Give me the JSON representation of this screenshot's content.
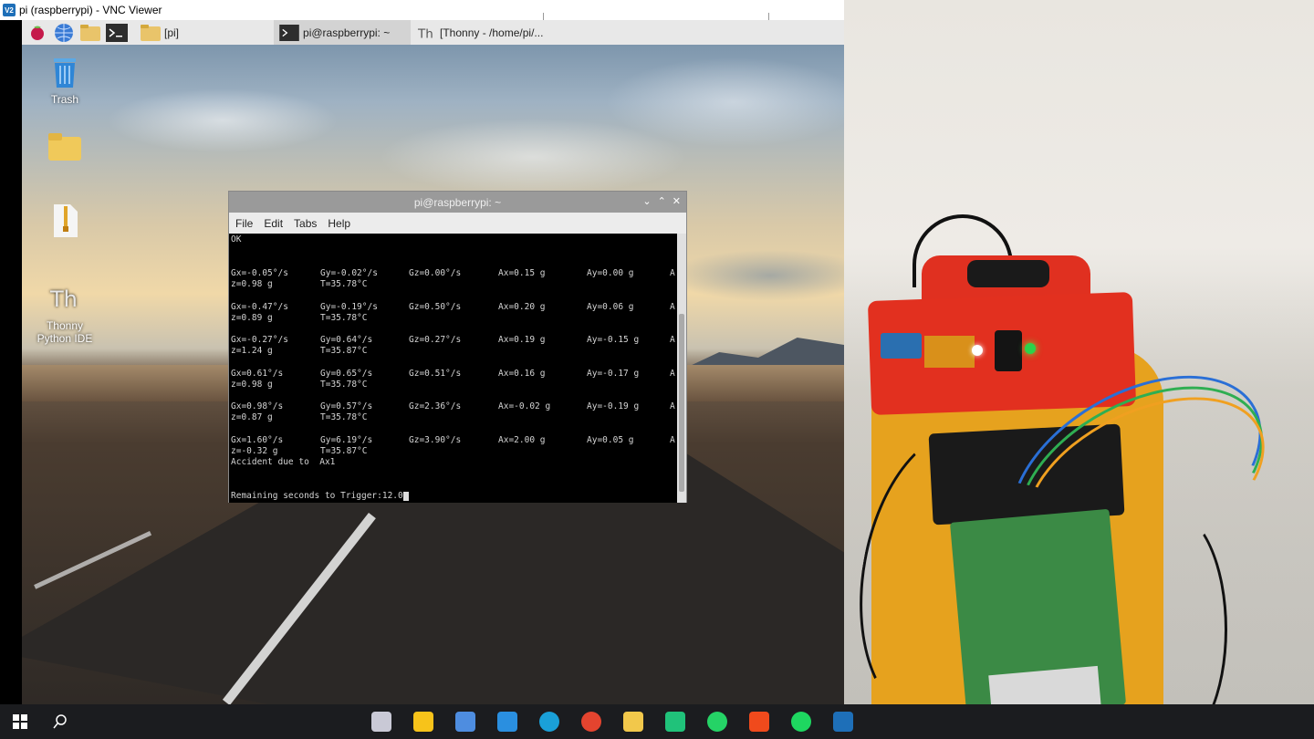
{
  "vnc": {
    "logo": "V2",
    "title": "pi (raspberrypi) - VNC Viewer"
  },
  "pi_taskbar": {
    "launchers": [
      "raspberry-menu-icon",
      "globe-icon",
      "files-icon",
      "terminal-icon"
    ],
    "tasks": [
      {
        "label": "[pi]",
        "icon": "folder-icon",
        "active": false
      },
      {
        "label": "pi@raspberrypi: ~",
        "icon": "terminal-icon",
        "active": true
      },
      {
        "label": "[Thonny  -  /home/pi/...",
        "icon": "thonny-icon",
        "active": false
      }
    ]
  },
  "desktop_icons": [
    {
      "label": "Trash",
      "icon": "trash-icon"
    },
    {
      "label": "",
      "icon": "folder-icon"
    },
    {
      "label": "",
      "icon": "archive-icon"
    },
    {
      "label": "Thonny\nPython IDE",
      "icon": "thonny-icon"
    }
  ],
  "terminal": {
    "title": "pi@raspberrypi: ~",
    "menu": [
      "File",
      "Edit",
      "Tabs",
      "Help"
    ],
    "first_line": "OK",
    "readings": [
      {
        "gx": "Gx=-0.05°/s",
        "gy": "Gy=-0.02°/s",
        "gz": "Gz=0.00°/s",
        "ax": "Ax=0.15 g",
        "ay": "Ay=0.00 g",
        "az": "A",
        "z": "z=0.98 g",
        "t": "T=35.78°C"
      },
      {
        "gx": "Gx=-0.47°/s",
        "gy": "Gy=-0.19°/s",
        "gz": "Gz=0.50°/s",
        "ax": "Ax=0.20 g",
        "ay": "Ay=0.06 g",
        "az": "A",
        "z": "z=0.89 g",
        "t": "T=35.78°C"
      },
      {
        "gx": "Gx=-0.27°/s",
        "gy": "Gy=0.64°/s",
        "gz": "Gz=0.27°/s",
        "ax": "Ax=0.19 g",
        "ay": "Ay=-0.15 g",
        "az": "A",
        "z": "z=1.24 g",
        "t": "T=35.87°C"
      },
      {
        "gx": "Gx=0.61°/s",
        "gy": "Gy=0.65°/s",
        "gz": "Gz=0.51°/s",
        "ax": "Ax=0.16 g",
        "ay": "Ay=-0.17 g",
        "az": "A",
        "z": "z=0.98 g",
        "t": "T=35.78°C"
      },
      {
        "gx": "Gx=0.98°/s",
        "gy": "Gy=0.57°/s",
        "gz": "Gz=2.36°/s",
        "ax": "Ax=-0.02 g",
        "ay": "Ay=-0.19 g",
        "az": "A",
        "z": "z=0.87 g",
        "t": "T=35.78°C"
      },
      {
        "gx": "Gx=1.60°/s",
        "gy": "Gy=6.19°/s",
        "gz": "Gz=3.90°/s",
        "ax": "Ax=2.00 g",
        "ay": "Ay=0.05 g",
        "az": "A",
        "z": "z=-0.32 g",
        "t": "T=35.87°C"
      }
    ],
    "accident_line": "Accident due to  Ax1",
    "remaining_line": "Remaining seconds to Trigger:12.0"
  },
  "win_taskbar": {
    "apps": [
      "teams-icon",
      "sticky-notes-icon",
      "store-icon",
      "vscode-icon",
      "edge-icon",
      "chrome-icon",
      "file-explorer-icon",
      "pycharm-icon",
      "whatsapp-icon",
      "brave-icon",
      "spotify-icon",
      "vnc-icon"
    ],
    "colors": [
      "#c9c9d6",
      "#f7c31a",
      "#4e8de0",
      "#2a8fe0",
      "#1aa0d8",
      "#e4442f",
      "#f2c84b",
      "#20c27a",
      "#25d366",
      "#f04a1c",
      "#1ed760",
      "#1e6fb8"
    ]
  }
}
